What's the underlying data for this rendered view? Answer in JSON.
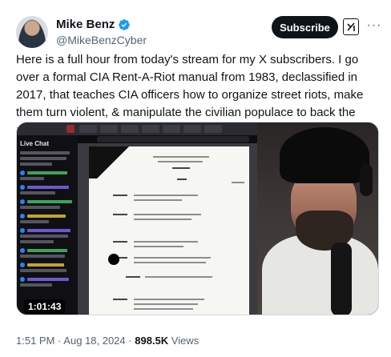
{
  "author": {
    "name": "Mike Benz",
    "handle": "@MikeBenzCyber",
    "verified_icon": "verified-badge-icon",
    "verified_color": "#1d9bf0"
  },
  "actions": {
    "subscribe_label": "Subscribe",
    "grok_icon": "grok-icon",
    "more_icon": "more-options-icon",
    "more_glyph": "···"
  },
  "tweet": {
    "text": "Here is a full hour from today's stream for my X subscribers. I go over a formal CIA Rent-A-Riot manual from 1983, declassified in 2017, that teaches CIA officers how to organize street riots, make them turn violent, & manipulate the civilian populace to back the rioters' cause."
  },
  "media": {
    "type": "video",
    "duration": "1:01:43",
    "chat_title": "Live Chat"
  },
  "meta": {
    "time": "1:51 PM",
    "separator": "·",
    "date": "Aug 18, 2024",
    "views_count": "898.5K",
    "views_label": "Views"
  },
  "colors": {
    "primary_text": "#0f1419",
    "secondary_text": "#536471",
    "button_bg": "#0f1419"
  }
}
